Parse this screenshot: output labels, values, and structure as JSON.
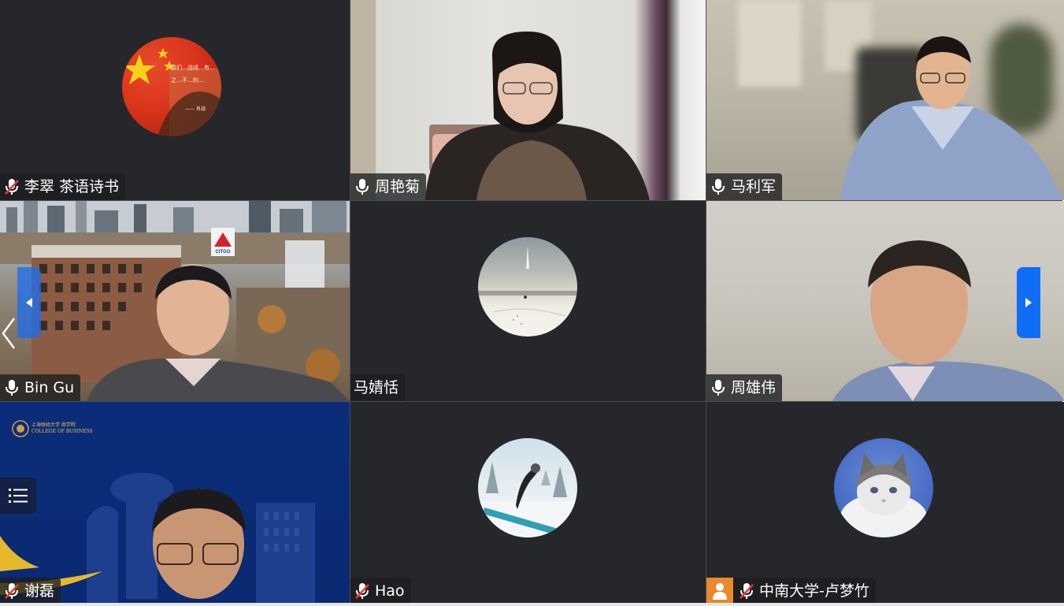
{
  "participants": [
    {
      "name": "李翠  茶语诗书",
      "mic": "muted",
      "avatar": "flag-avatar",
      "video": false
    },
    {
      "name": "周艳菊",
      "mic": "on",
      "video": true
    },
    {
      "name": "马利军",
      "mic": "on",
      "video": true
    },
    {
      "name": "Bin Gu",
      "mic": "on",
      "video": true
    },
    {
      "name": "马婧恬",
      "mic": "none",
      "avatar": "snow-landscape-avatar",
      "video": false
    },
    {
      "name": "周雄伟",
      "mic": "on",
      "video": true
    },
    {
      "name": "谢磊",
      "mic": "muted",
      "video": true
    },
    {
      "name": "Hao",
      "mic": "muted",
      "avatar": "snowboarder-avatar",
      "video": false
    },
    {
      "name": "中南大学-卢梦竹",
      "mic": "muted",
      "avatar": "cat-avatar",
      "video": false
    }
  ],
  "flag_avatar": {
    "poem_lines": [
      "我们…战成…有…",
      "之…不…的…",
      "—— 肖战"
    ]
  },
  "college_logo": {
    "cn": "上海财经大学 商学院",
    "en": "COLLEGE OF BUSINESS"
  },
  "billboard_text": "CITGO",
  "colors": {
    "accent_blue": "#0f6ef5",
    "tile_bg": "#25272b",
    "nametag_bg": "#1c1d20",
    "mic_on_color": "#ffffff",
    "mic_muted_slash": "#e53935",
    "orange_avatar": "#e8892b"
  },
  "icons": {
    "mic": "microphone-icon",
    "mic_muted": "microphone-muted-icon",
    "next": "chevron-right-icon",
    "prev": "chevron-left-icon",
    "list": "list-icon",
    "user": "user-icon"
  }
}
